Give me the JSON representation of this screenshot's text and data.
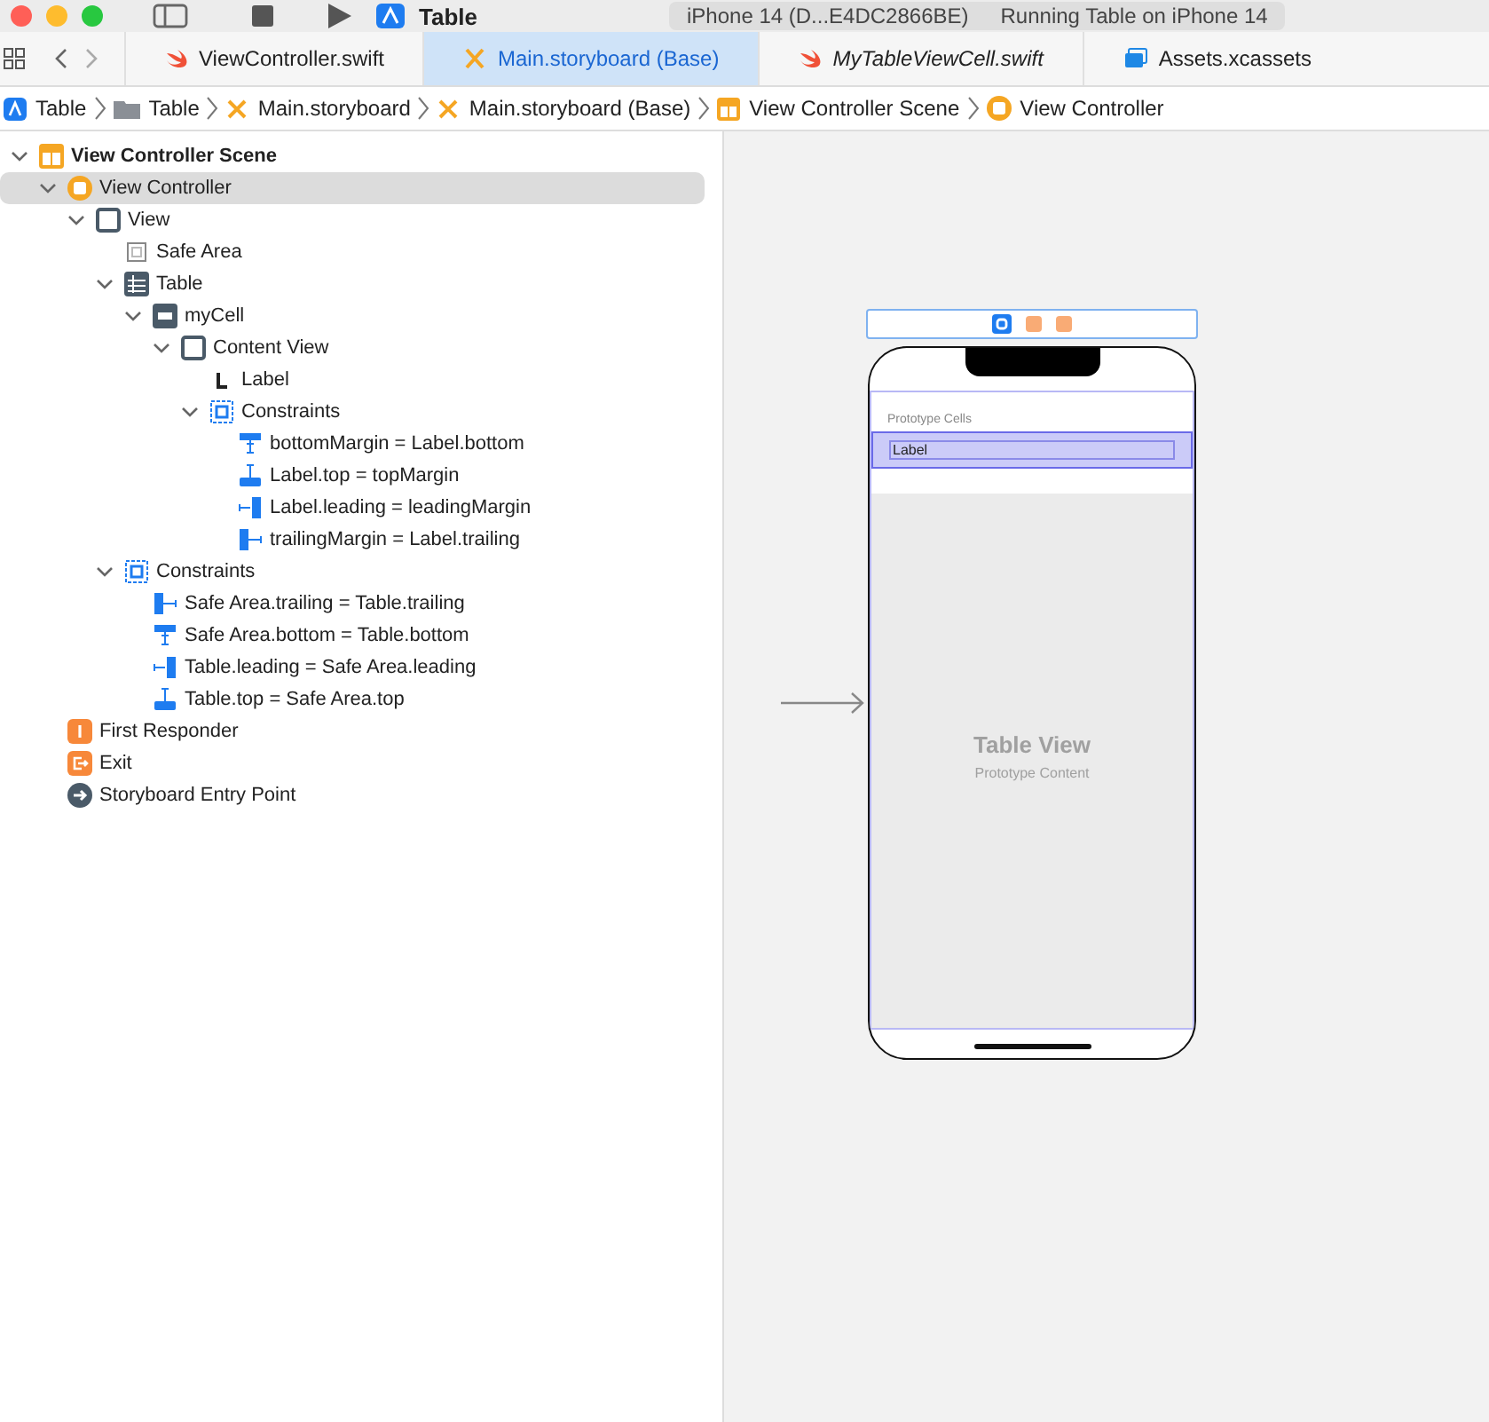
{
  "toolbar": {
    "scheme": "Table",
    "destination": "iPhone 14 (D...E4DC2866BE)",
    "status": "Running Table on iPhone 14"
  },
  "tabs": [
    {
      "label": "ViewController.swift",
      "kind": "swift",
      "selected": false,
      "preview": false
    },
    {
      "label": "Main.storyboard (Base)",
      "kind": "storyboard",
      "selected": true,
      "preview": false
    },
    {
      "label": "MyTableViewCell.swift",
      "kind": "swift",
      "selected": false,
      "preview": true
    },
    {
      "label": "Assets.xcassets",
      "kind": "assets",
      "selected": false,
      "preview": false
    }
  ],
  "breadcrumb": [
    {
      "label": "Table",
      "kind": "project"
    },
    {
      "label": "Table",
      "kind": "folder"
    },
    {
      "label": "Main.storyboard",
      "kind": "storyboard"
    },
    {
      "label": "Main.storyboard (Base)",
      "kind": "storyboard"
    },
    {
      "label": "View Controller Scene",
      "kind": "scene"
    },
    {
      "label": "View Controller",
      "kind": "vc"
    }
  ],
  "outline": [
    {
      "label": "View Controller Scene",
      "kind": "scene",
      "bold": true,
      "selected": false,
      "expanded": true,
      "children": [
        {
          "label": "View Controller",
          "kind": "vc",
          "bold": false,
          "selected": true,
          "expanded": true,
          "children": [
            {
              "label": "View",
              "kind": "view",
              "bold": false,
              "selected": false,
              "expanded": true,
              "children": [
                {
                  "label": "Safe Area",
                  "kind": "safearea",
                  "bold": false,
                  "selected": false
                },
                {
                  "label": "Table",
                  "kind": "table",
                  "bold": false,
                  "selected": false,
                  "expanded": true,
                  "children": [
                    {
                      "label": "myCell",
                      "kind": "cell",
                      "bold": false,
                      "selected": false,
                      "expanded": true,
                      "children": [
                        {
                          "label": "Content View",
                          "kind": "view",
                          "bold": false,
                          "selected": false,
                          "expanded": true,
                          "children": [
                            {
                              "label": "Label",
                              "kind": "label",
                              "bold": false,
                              "selected": false
                            },
                            {
                              "label": "Constraints",
                              "kind": "constraints",
                              "bold": false,
                              "selected": false,
                              "expanded": true,
                              "children": [
                                {
                                  "label": "bottomMargin = Label.bottom",
                                  "kind": "c-bottom",
                                  "bold": false,
                                  "selected": false
                                },
                                {
                                  "label": "Label.top = topMargin",
                                  "kind": "c-top",
                                  "bold": false,
                                  "selected": false
                                },
                                {
                                  "label": "Label.leading = leadingMargin",
                                  "kind": "c-leading",
                                  "bold": false,
                                  "selected": false
                                },
                                {
                                  "label": "trailingMargin = Label.trailing",
                                  "kind": "c-trailing",
                                  "bold": false,
                                  "selected": false
                                }
                              ]
                            }
                          ]
                        }
                      ]
                    }
                  ]
                },
                {
                  "label": "Constraints",
                  "kind": "constraints",
                  "bold": false,
                  "selected": false,
                  "expanded": true,
                  "children": [
                    {
                      "label": "Safe Area.trailing = Table.trailing",
                      "kind": "c-trailing",
                      "bold": false,
                      "selected": false
                    },
                    {
                      "label": "Safe Area.bottom = Table.bottom",
                      "kind": "c-bottom",
                      "bold": false,
                      "selected": false
                    },
                    {
                      "label": "Table.leading = Safe Area.leading",
                      "kind": "c-leading",
                      "bold": false,
                      "selected": false
                    },
                    {
                      "label": "Table.top = Safe Area.top",
                      "kind": "c-top",
                      "bold": false,
                      "selected": false
                    }
                  ]
                }
              ]
            }
          ]
        },
        {
          "label": "First Responder",
          "kind": "responder",
          "bold": false,
          "selected": false
        },
        {
          "label": "Exit",
          "kind": "exit",
          "bold": false,
          "selected": false
        },
        {
          "label": "Storyboard Entry Point",
          "kind": "entry",
          "bold": false,
          "selected": false
        }
      ]
    }
  ],
  "canvas": {
    "section_header": "Prototype Cells",
    "cell_label": "Label",
    "placeholder_title": "Table View",
    "placeholder_subtitle": "Prototype Content"
  }
}
